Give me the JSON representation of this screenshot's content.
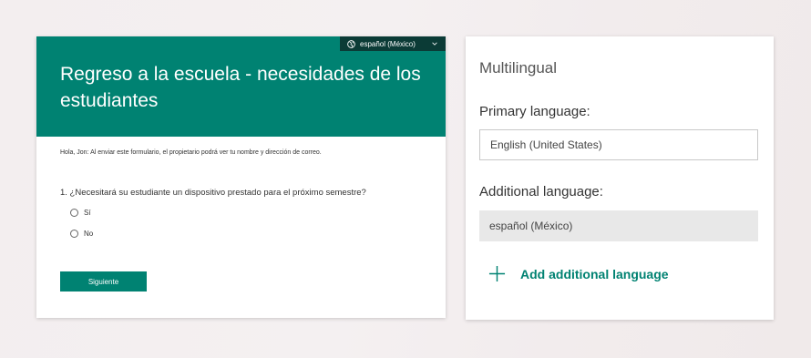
{
  "form_preview": {
    "language_selector": {
      "icon": "globe-icon",
      "value": "español (México)",
      "chevron": "chevron-down-icon"
    },
    "title": "Regreso a la escuela - necesidades de los estudiantes",
    "notice": "Hola, Jon: Al enviar este formulario, el propietario podrá ver tu nombre y dirección de correo.",
    "question": "1. ¿Necesitará su estudiante un dispositivo prestado para el próximo semestre?",
    "options": [
      "Sí",
      "No"
    ],
    "next_label": "Siguiente",
    "colors": {
      "header": "#008272",
      "language_bar": "#0b3b36",
      "button": "#008272"
    }
  },
  "settings": {
    "title": "Multilingual",
    "primary_label": "Primary language:",
    "primary_value": "English (United States)",
    "additional_label": "Additional language:",
    "additional_value": "español (México)",
    "add_label": "Add additional language",
    "add_icon": "plus-icon",
    "colors": {
      "accent": "#008272",
      "selected_item_bg": "#e8e8e8"
    }
  }
}
